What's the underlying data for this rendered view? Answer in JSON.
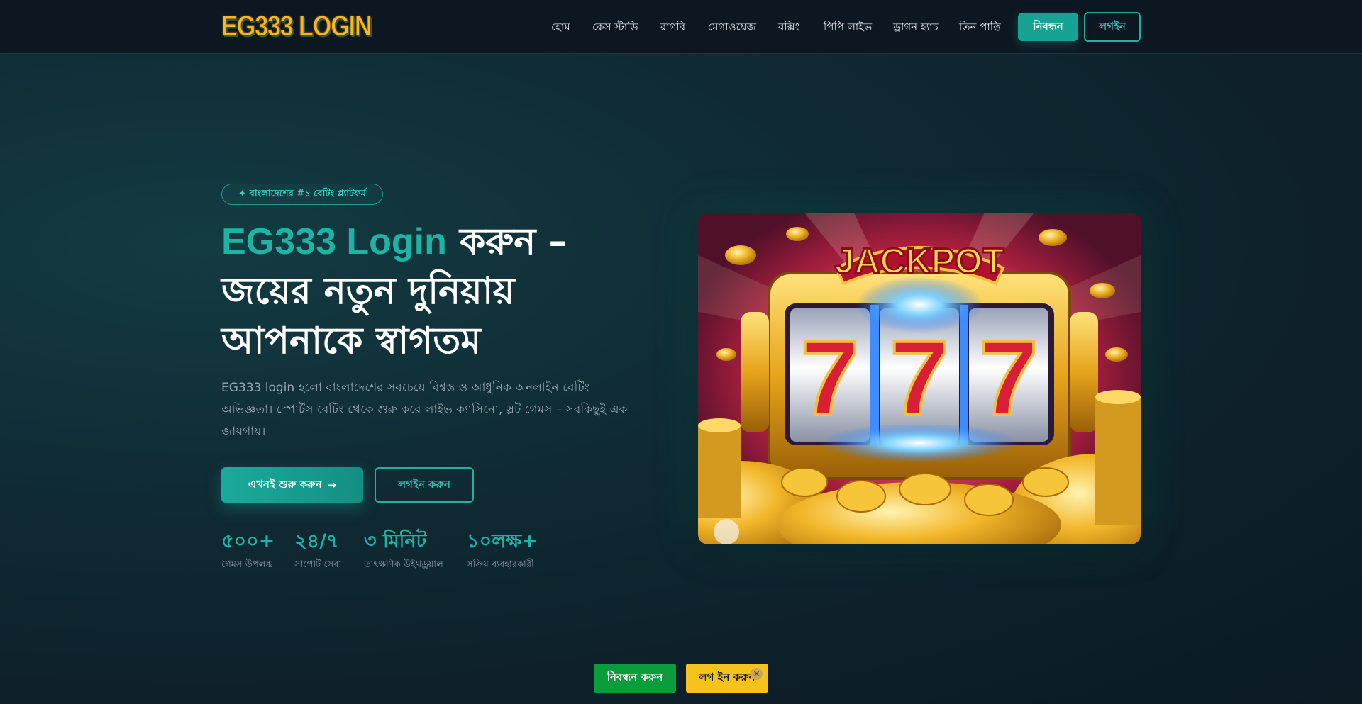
{
  "header": {
    "logo_text": "EG333 LOGIN",
    "nav": [
      {
        "label": "হোম"
      },
      {
        "label": "কেস স্টাডি"
      },
      {
        "label": "রাগবি"
      },
      {
        "label": "মেগাওয়েজ"
      },
      {
        "label": "বক্সিং"
      },
      {
        "label": "পিপি লাইভ"
      },
      {
        "label": "ড্রাগন হ্যাচ"
      },
      {
        "label": "তিন পাত্তি"
      }
    ],
    "register_label": "নিবন্ধন",
    "login_label": "লগইন"
  },
  "hero": {
    "badge": "✦ বাংলাদেশের #১ বেটিং প্ল্যাটফর্ম",
    "title_accent": "EG333 Login",
    "title_rest": " করুন – জয়ের নতুন দুনিয়ায় আপনাকে স্বাগতম",
    "description": "EG333 login হলো বাংলাদেশের সবচেয়ে বিশ্বস্ত ও আধুনিক অনলাইন বেটিং অভিজ্ঞতা। স্পোর্টস বেটিং থেকে শুরু করে লাইভ ক্যাসিনো, স্লট গেমস – সবকিছুই এক জায়গায়।",
    "start_button": "এখনই শুরু করুন",
    "start_arrow": "→",
    "login_button": "লগইন করুন",
    "stats": [
      {
        "value": "৫০০+",
        "label": "গেমস উপলব্ধ"
      },
      {
        "value": "২৪/৭",
        "label": "সাপোর্ট সেবা"
      },
      {
        "value": "৩ মিনিট",
        "label": "তাৎক্ষণিক উইথড্রয়াল"
      },
      {
        "value": "১০লক্ষ+",
        "label": "সক্রিয় ব্যবহারকারী"
      }
    ],
    "image": {
      "jackpot_text": "JACKPOT",
      "reel_symbols": [
        "7",
        "7",
        "7"
      ]
    }
  },
  "floating_bar": {
    "register_label": "নিবন্ধন করুন",
    "login_label": "লগ ইন করুন",
    "close_symbol": "×"
  },
  "colors": {
    "accent": "#1fb3a3",
    "header_bg": "#0d1722",
    "float_register": "#0b9c3d",
    "float_login": "#f6c21c"
  }
}
